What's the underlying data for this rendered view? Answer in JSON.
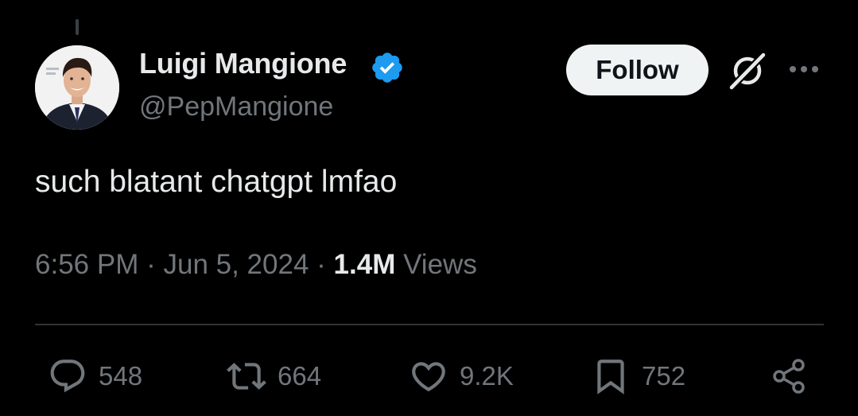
{
  "author": {
    "display_name": "Luigi Mangione",
    "handle": "@PepMangione",
    "verified": true
  },
  "header": {
    "follow_label": "Follow",
    "grok_icon": "grok-icon",
    "more_icon": "more-dots-icon"
  },
  "tweet": {
    "text": "such blatant chatgpt lmfao",
    "time": "6:56 PM",
    "separator": "·",
    "date": "Jun 5, 2024",
    "views_count": "1.4M",
    "views_label": "Views"
  },
  "actions": {
    "reply_count": "548",
    "retweet_count": "664",
    "like_count": "9.2K",
    "bookmark_count": "752"
  },
  "colors": {
    "background": "#000000",
    "primary_text": "#e7e9ea",
    "secondary_text": "#71767b",
    "verified_blue": "#1d9bf0",
    "follow_button_bg": "#eff3f4",
    "divider": "#2f3336"
  }
}
